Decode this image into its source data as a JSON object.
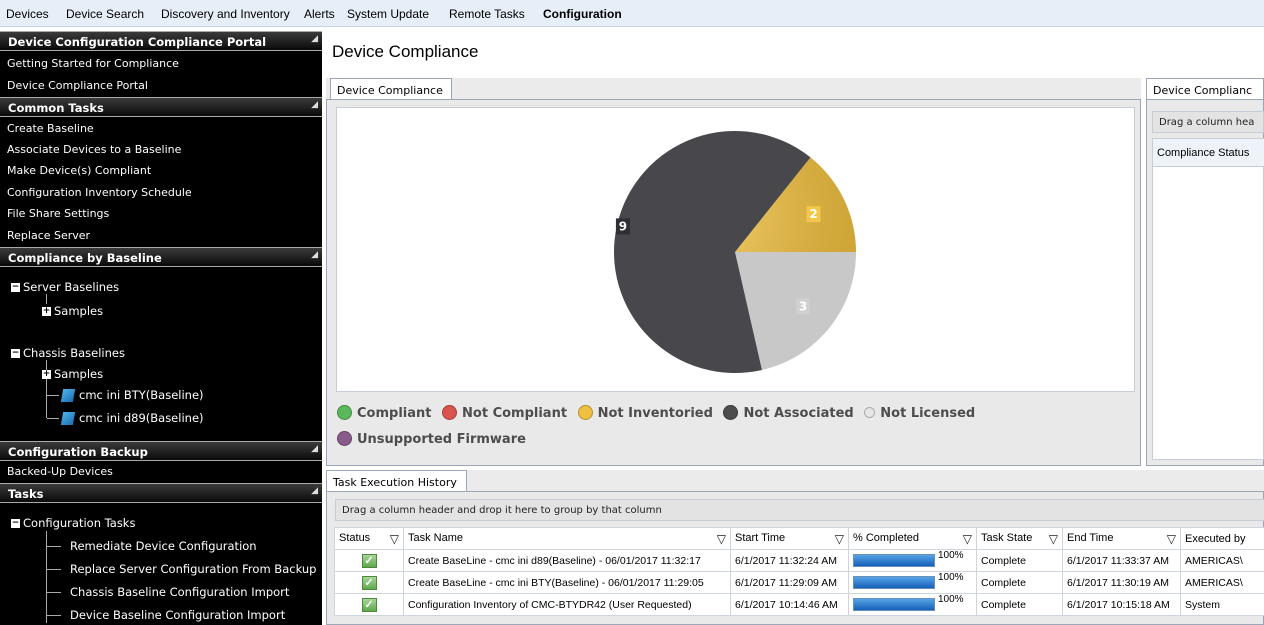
{
  "top_menu": {
    "items": [
      "Devices",
      "Device Search",
      "Discovery and Inventory",
      "Alerts",
      "System Update",
      "Remote Tasks",
      "Configuration"
    ],
    "active": "Configuration"
  },
  "sidebar": {
    "portal_header": "Device Configuration Compliance Portal",
    "portal_links": [
      "Getting Started for Compliance",
      "Device Compliance Portal"
    ],
    "common_header": "Common Tasks",
    "common_links": [
      "Create Baseline",
      "Associate Devices to a Baseline",
      "Make Device(s) Compliant",
      "Configuration Inventory Schedule",
      "File Share Settings",
      "Replace Server"
    ],
    "baseline_header": "Compliance by Baseline",
    "server_baselines": "Server Baselines",
    "server_samples": "Samples",
    "chassis_baselines": "Chassis Baselines",
    "chassis_samples": "Samples",
    "baseline_items": [
      "cmc ini BTY(Baseline)",
      "cmc ini d89(Baseline)"
    ],
    "backup_header": "Configuration Backup",
    "backup_links": [
      "Backed-Up Devices"
    ],
    "tasks_header": "Tasks",
    "config_tasks": "Configuration Tasks",
    "task_items": [
      "Remediate Device Configuration",
      "Replace Server Configuration From Backup",
      "Chassis Baseline Configuration Import",
      "Device Baseline Configuration Import"
    ]
  },
  "page_title": "Device Compliance",
  "compliance_panel": {
    "tab_label": "Device Compliance",
    "legend": [
      {
        "label": "Compliant",
        "color": "#5cb85c"
      },
      {
        "label": "Not Compliant",
        "color": "#d9534f"
      },
      {
        "label": "Not Inventoried",
        "color": "#f0c040"
      },
      {
        "label": "Not Associated",
        "color": "#4d4d4d"
      },
      {
        "label": "Not Licensed",
        "color": "#d6d6d6"
      },
      {
        "label": "Unsupported Firmware",
        "color": "#8a5a8a"
      }
    ]
  },
  "chart_data": {
    "type": "pie",
    "categories": [
      "Not Associated",
      "Not Inventoried",
      "Not Licensed"
    ],
    "values": [
      9,
      2,
      3
    ],
    "colors": [
      "#47474c",
      "#f0be3a",
      "#c8c8c8"
    ],
    "title": "",
    "legend": "bottom"
  },
  "right_panel": {
    "tab_label": "Device Complianc",
    "group_hint": "Drag a column hea",
    "column": "Compliance Status"
  },
  "task_panel": {
    "tab_label": "Task Execution History",
    "group_hint": "Drag a column header and drop it here to group by that column",
    "columns": [
      "Status",
      "Task Name",
      "Start Time",
      "% Completed",
      "Task State",
      "End Time",
      "Executed by"
    ],
    "rows": [
      {
        "task": "Create BaseLine - cmc ini d89(Baseline) - 06/01/2017 11:32:17",
        "start": "6/1/2017 11:32:24 AM",
        "pct": "100%",
        "state": "Complete",
        "end": "6/1/2017 11:33:37 AM",
        "by": "AMERICAS\\"
      },
      {
        "task": "Create BaseLine - cmc ini BTY(Baseline) - 06/01/2017 11:29:05",
        "start": "6/1/2017 11:29:09 AM",
        "pct": "100%",
        "state": "Complete",
        "end": "6/1/2017 11:30:19 AM",
        "by": "AMERICAS\\"
      },
      {
        "task": "Configuration Inventory of CMC-BTYDR42 (User Requested)",
        "start": "6/1/2017 10:14:46 AM",
        "pct": "100%",
        "state": "Complete",
        "end": "6/1/2017 10:15:18 AM",
        "by": "System"
      }
    ]
  }
}
